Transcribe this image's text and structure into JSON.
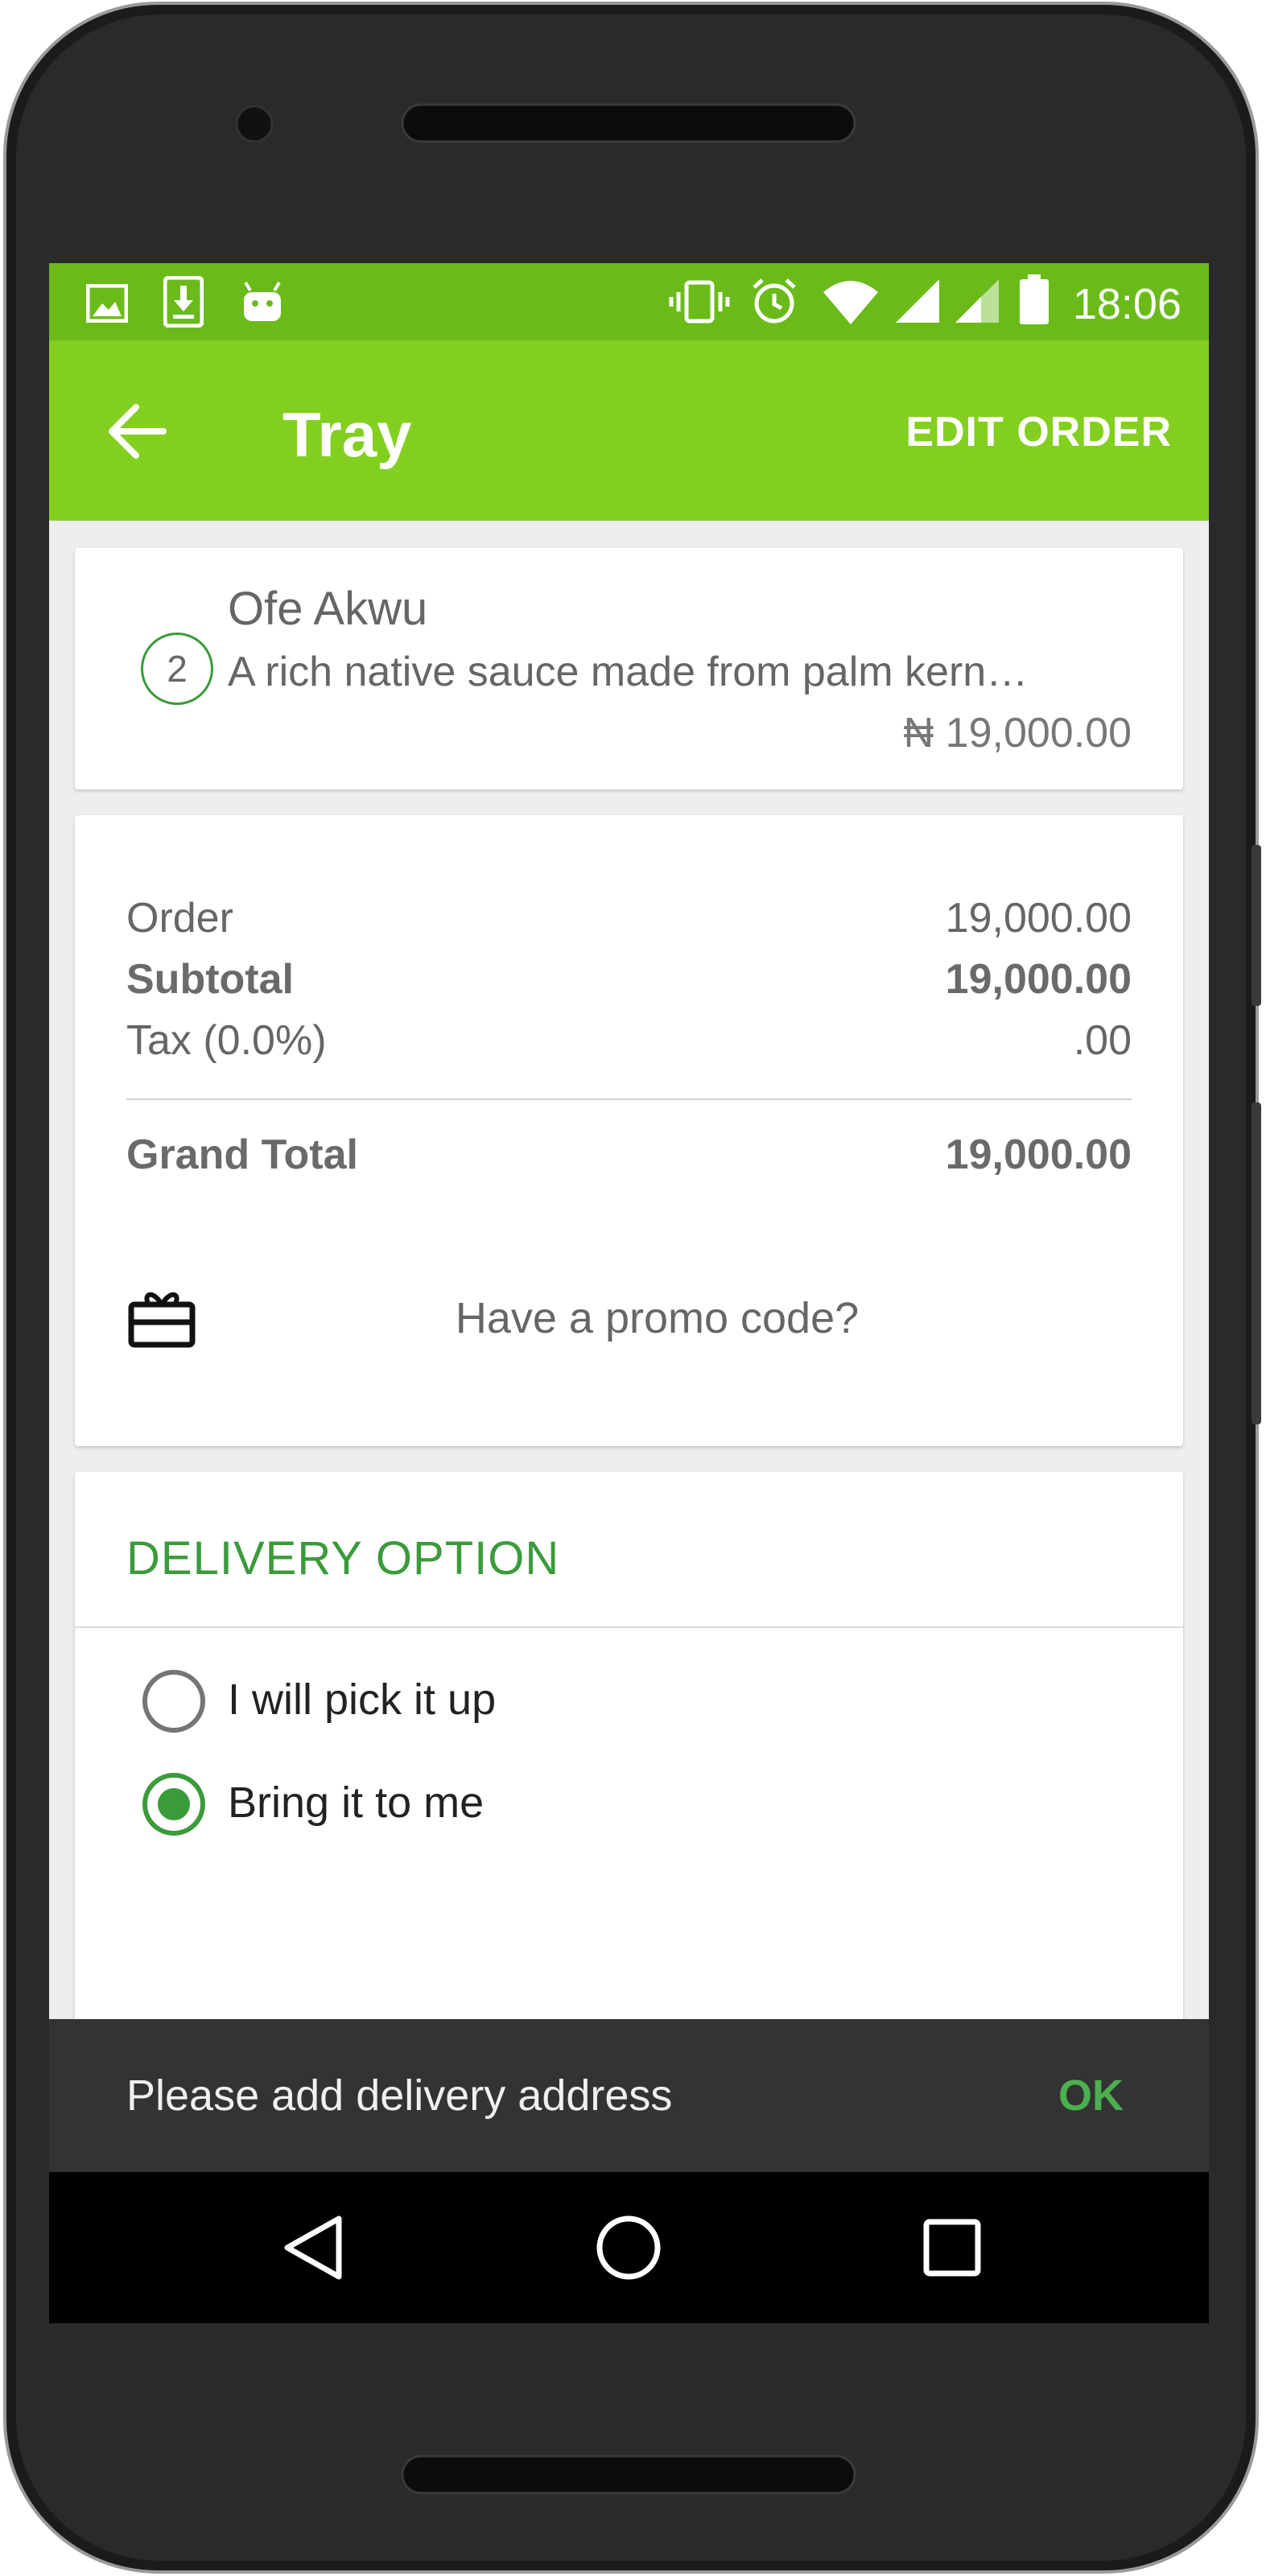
{
  "status_bar": {
    "time": "18:06",
    "left_icons": [
      "image-icon",
      "download-icon",
      "android-icon"
    ],
    "right_icons": [
      "vibrate-icon",
      "alarm-icon",
      "wifi-icon",
      "signal-icon",
      "signal-icon",
      "battery-icon"
    ]
  },
  "app_bar": {
    "title": "Tray",
    "action_label": "EDIT ORDER",
    "back_icon": "arrow-back-icon"
  },
  "order_item": {
    "quantity": "2",
    "name": "Ofe Akwu",
    "description": "A rich native sauce made from palm kern…",
    "price": "₦ 19,000.00"
  },
  "totals": {
    "order_label": "Order",
    "order_value": "19,000.00",
    "subtotal_label": "Subtotal",
    "subtotal_value": "19,000.00",
    "tax_label": "Tax (0.0%)",
    "tax_value": ".00",
    "grand_total_label": "Grand Total",
    "grand_total_value": "19,000.00"
  },
  "promo": {
    "text": "Have a promo code?",
    "icon": "gift-card-icon"
  },
  "delivery": {
    "title": "DELIVERY OPTION",
    "options": [
      {
        "label": "I will pick it up",
        "selected": false
      },
      {
        "label": "Bring it to me",
        "selected": true
      }
    ]
  },
  "snackbar": {
    "message": "Please add delivery address",
    "action": "OK"
  },
  "colors": {
    "status_bar": "#6abb1a",
    "app_bar": "#82cf1f",
    "accent_green": "#3a9b3a",
    "snackbar": "#333333"
  }
}
